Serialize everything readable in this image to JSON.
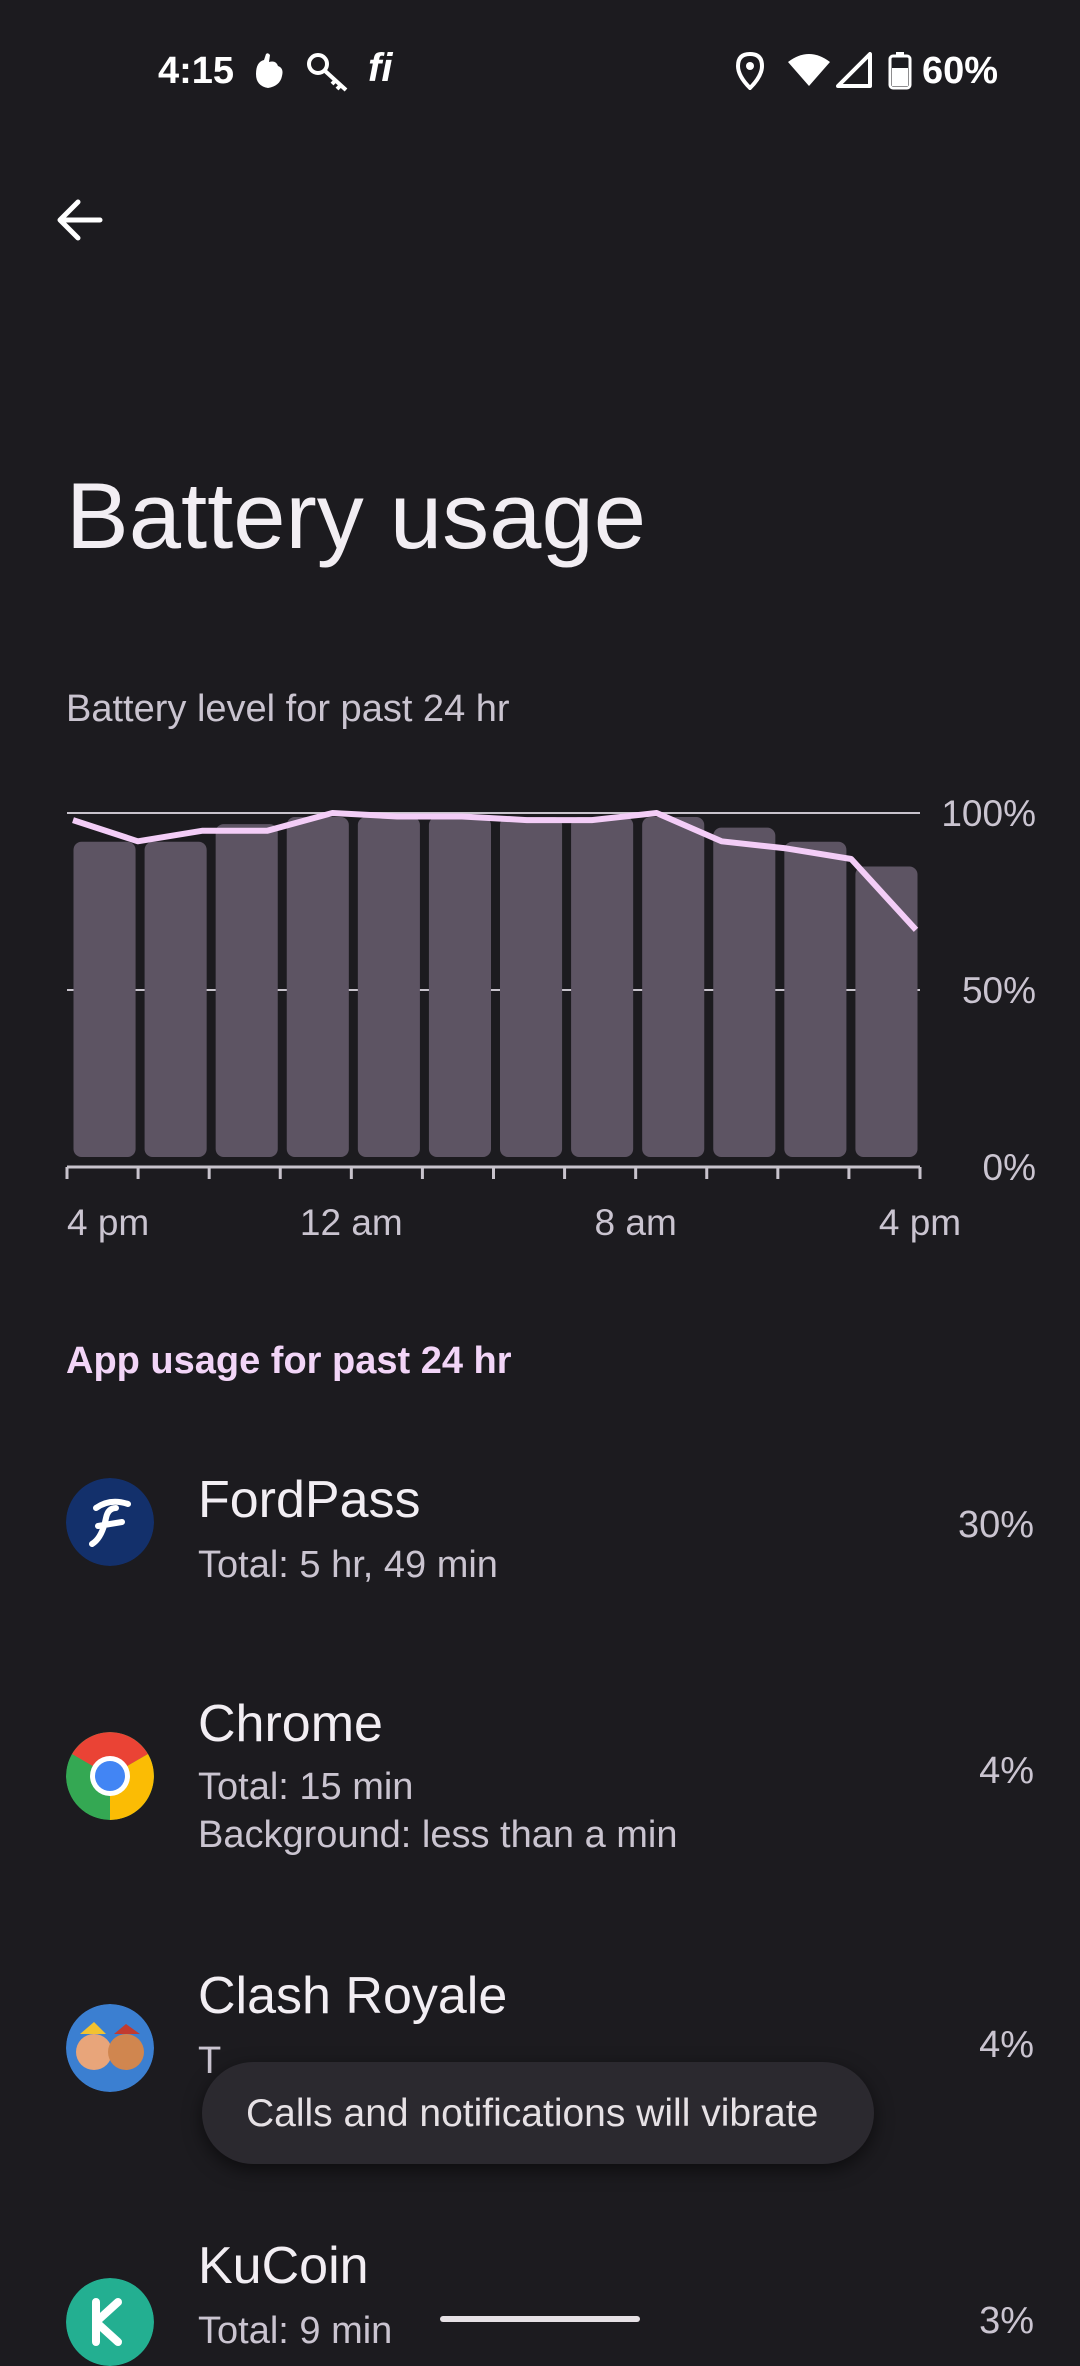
{
  "status_bar": {
    "time": "4:15",
    "icons_left": [
      "hand-icon",
      "key-icon",
      "fi-icon"
    ],
    "fi_label": "fi",
    "icons_right": [
      "location-icon",
      "wifi-icon",
      "signal-icon",
      "battery-icon"
    ],
    "battery_percent": "60%"
  },
  "header": {
    "back_icon": "arrow-back-icon",
    "title": "Battery usage"
  },
  "chart": {
    "subtitle": "Battery level for past 24 hr",
    "colors": {
      "bars": "#5d5463",
      "line": "#f3cdf7",
      "grid": "#c8c3cc"
    }
  },
  "chart_data": {
    "type": "bar",
    "values": [
      93,
      93,
      98,
      100,
      100,
      100,
      100,
      100,
      100,
      97,
      93,
      86
    ],
    "series": [
      {
        "type": "line",
        "values": [
          98,
          92,
          95,
          95,
          100,
          99,
          99,
          98,
          98,
          100,
          92,
          90,
          87,
          67
        ]
      }
    ],
    "x_tick_labels": [
      "4 pm",
      "12 am",
      "8 am",
      "4 pm"
    ],
    "y_tick_labels": [
      "100%",
      "50%",
      "0%"
    ],
    "ylim": [
      0,
      100
    ],
    "grid": true
  },
  "section": {
    "title": "App usage for past 24 hr"
  },
  "apps": [
    {
      "name": "FordPass",
      "line1": "Total: 5 hr, 49 min",
      "line2": "",
      "percent": "30%",
      "icon": "fordpass-app-icon"
    },
    {
      "name": "Chrome",
      "line1": "Total: 15 min",
      "line2": "Background: less than a min",
      "percent": "4%",
      "icon": "chrome-app-icon"
    },
    {
      "name": "Clash Royale",
      "line1": "T",
      "line2": "",
      "percent": "4%",
      "icon": "clash-royale-app-icon"
    },
    {
      "name": "KuCoin",
      "line1": "Total: 9 min",
      "line2": "",
      "percent": "3%",
      "icon": "kucoin-app-icon"
    }
  ],
  "toast": {
    "message": "Calls and notifications will vibrate"
  }
}
